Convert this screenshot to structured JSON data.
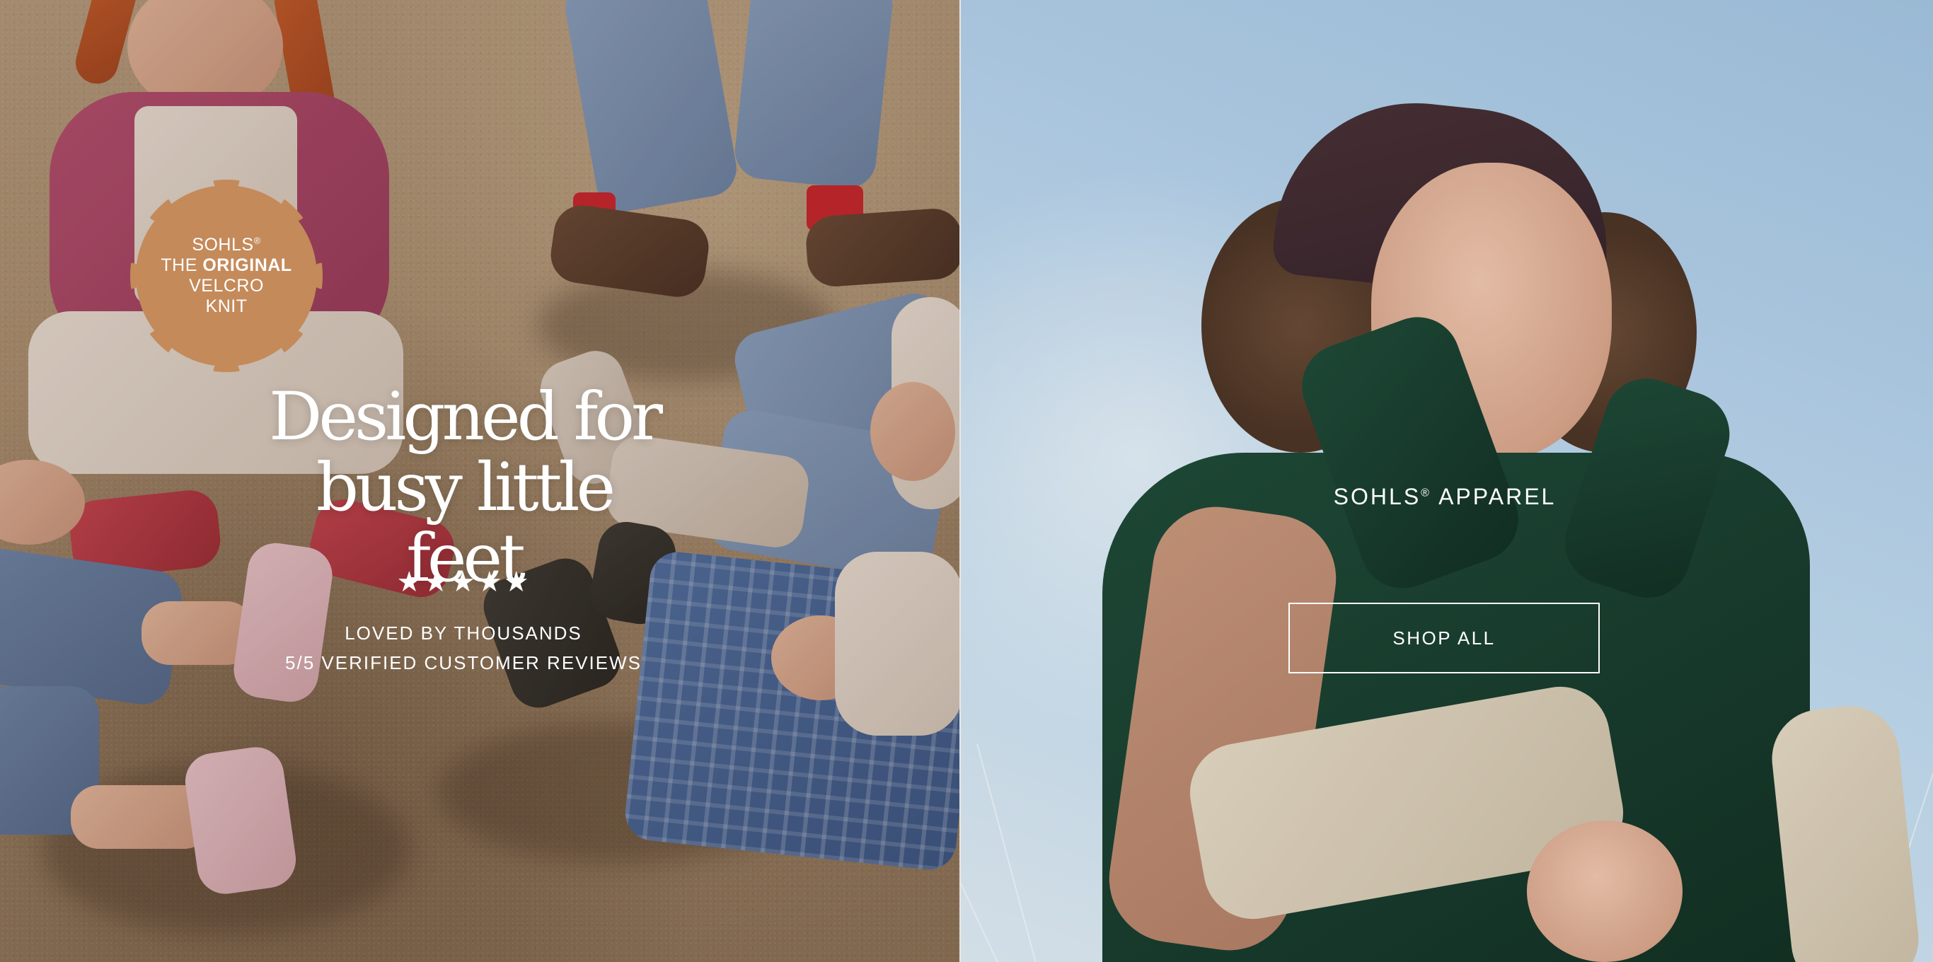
{
  "left_panel": {
    "badge": {
      "line1_brand": "SOHLS",
      "line1_mark": "®",
      "line2_prefix": "THE ",
      "line2_bold": "ORIGINAL",
      "line3": "VELCRO",
      "line4": "KNIT",
      "color": "#c48a5a"
    },
    "headline": {
      "line1": "Designed for",
      "line2": "busy little feet"
    },
    "rating": {
      "stars": "★★★★★",
      "value": 5,
      "max": 5
    },
    "reviews": {
      "line1": "LOVED BY THOUSANDS",
      "line2": "5/5 VERIFIED CUSTOMER REVIEWS"
    }
  },
  "right_panel": {
    "title_brand": "SOHLS",
    "title_mark": "®",
    "title_rest": " APPAREL",
    "cta_label": "SHOP ALL"
  },
  "colors": {
    "text": "#ffffff",
    "badge": "#c48a5a",
    "sky": "#b5d1ea",
    "vest": "#1f4a37"
  }
}
